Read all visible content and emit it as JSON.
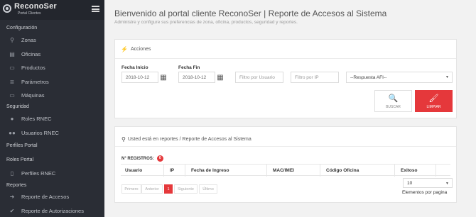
{
  "brand": {
    "name": "ReconoSer",
    "tagline": "Portal Clientes"
  },
  "sidebar": {
    "sections": [
      {
        "label": "Configuración"
      },
      {
        "label": "Seguridad"
      },
      {
        "label": "Perfiles Portal"
      },
      {
        "label": "Roles Portal"
      },
      {
        "label": "Reportes"
      }
    ],
    "items": [
      {
        "label": "Zonas",
        "icon": "map-marker-icon"
      },
      {
        "label": "Oficinas",
        "icon": "file-icon"
      },
      {
        "label": "Productos",
        "icon": "credit-card-icon"
      },
      {
        "label": "Parámetros",
        "icon": "list-icon"
      },
      {
        "label": "Máquinas",
        "icon": "monitor-icon"
      },
      {
        "label": "Roles RNEC",
        "icon": "user-icon"
      },
      {
        "label": "Usuarios RNEC",
        "icon": "users-icon"
      },
      {
        "label": "Perfiles RNEC",
        "icon": "document-icon"
      },
      {
        "label": "Reporte de Accesos",
        "icon": "sign-in-icon"
      },
      {
        "label": "Reporte de Autorizaciones",
        "icon": "check-icon"
      }
    ]
  },
  "header": {
    "title": "Bienvenido al portal cliente ReconoSer | Reporte de Accesos al Sistema",
    "subtitle": "Administre y configure sus preferencias de zona, oficina, productos, seguridad y reportes."
  },
  "acciones": {
    "title": "Acciones",
    "fecha_inicio_label": "Fecha Inicio",
    "fecha_inicio_value": "2018-10-12",
    "fecha_fin_label": "Fecha Fin",
    "fecha_fin_value": "2018-10-12",
    "filtro_usuario_placeholder": "Filtro por Usuario",
    "filtro_ip_placeholder": "Filtro por IP",
    "respuesta_select": "--Respuesta AFI--",
    "buscar_label": "BUSCAR",
    "limpiar_label": "LIMPIAR"
  },
  "reportes": {
    "breadcrumb": "Usted está en reportes / Reporte de Accesos al Sistema",
    "registros_label": "N° REGISTROS:",
    "registros_count": "0",
    "columns": [
      "Usuario",
      "IP",
      "Fecha de Ingreso",
      "MAC/IMEI",
      "Código Oficina",
      "Exitoso"
    ],
    "pagination": [
      "Primero",
      "Anterior",
      "1",
      "Siguiente",
      "Último"
    ],
    "page_length": "10",
    "page_length_label": "Elementos por pagina"
  },
  "colors": {
    "accent": "#e5383b",
    "sidebar": "#2a2d35"
  }
}
